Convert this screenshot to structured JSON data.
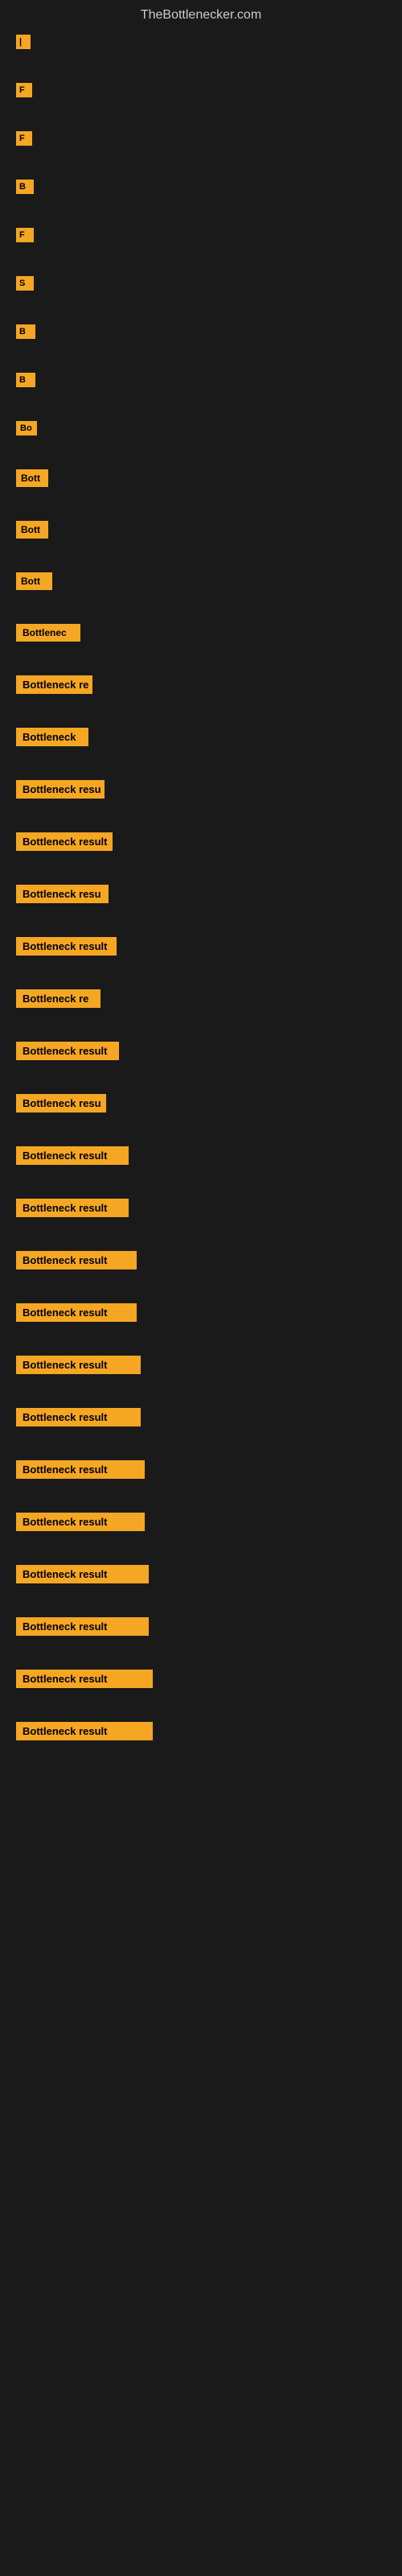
{
  "site": {
    "title": "TheBottlenecker.com"
  },
  "items": [
    {
      "id": 1,
      "label": "|",
      "class": "item-1"
    },
    {
      "id": 2,
      "label": "F",
      "class": "item-2"
    },
    {
      "id": 3,
      "label": "F",
      "class": "item-3"
    },
    {
      "id": 4,
      "label": "B",
      "class": "item-4"
    },
    {
      "id": 5,
      "label": "F",
      "class": "item-5"
    },
    {
      "id": 6,
      "label": "S",
      "class": "item-6"
    },
    {
      "id": 7,
      "label": "B",
      "class": "item-7"
    },
    {
      "id": 8,
      "label": "B",
      "class": "item-8"
    },
    {
      "id": 9,
      "label": "Bo",
      "class": "item-9"
    },
    {
      "id": 10,
      "label": "Bott",
      "class": "item-10"
    },
    {
      "id": 11,
      "label": "Bott",
      "class": "item-11"
    },
    {
      "id": 12,
      "label": "Bott",
      "class": "item-12"
    },
    {
      "id": 13,
      "label": "Bottlenec",
      "class": "item-13"
    },
    {
      "id": 14,
      "label": "Bottleneck re",
      "class": "item-14"
    },
    {
      "id": 15,
      "label": "Bottleneck",
      "class": "item-15"
    },
    {
      "id": 16,
      "label": "Bottleneck resu",
      "class": "item-16"
    },
    {
      "id": 17,
      "label": "Bottleneck result",
      "class": "item-17"
    },
    {
      "id": 18,
      "label": "Bottleneck resu",
      "class": "item-18"
    },
    {
      "id": 19,
      "label": "Bottleneck result",
      "class": "item-19"
    },
    {
      "id": 20,
      "label": "Bottleneck re",
      "class": "item-20"
    },
    {
      "id": 21,
      "label": "Bottleneck result",
      "class": "item-21"
    },
    {
      "id": 22,
      "label": "Bottleneck resu",
      "class": "item-22"
    },
    {
      "id": 23,
      "label": "Bottleneck result",
      "class": "item-23"
    },
    {
      "id": 24,
      "label": "Bottleneck result",
      "class": "item-24"
    },
    {
      "id": 25,
      "label": "Bottleneck result",
      "class": "item-25"
    },
    {
      "id": 26,
      "label": "Bottleneck result",
      "class": "item-26"
    },
    {
      "id": 27,
      "label": "Bottleneck result",
      "class": "item-27"
    },
    {
      "id": 28,
      "label": "Bottleneck result",
      "class": "item-28"
    },
    {
      "id": 29,
      "label": "Bottleneck result",
      "class": "item-29"
    },
    {
      "id": 30,
      "label": "Bottleneck result",
      "class": "item-30"
    },
    {
      "id": 31,
      "label": "Bottleneck result",
      "class": "item-31"
    },
    {
      "id": 32,
      "label": "Bottleneck result",
      "class": "item-32"
    },
    {
      "id": 33,
      "label": "Bottleneck result",
      "class": "item-33"
    },
    {
      "id": 34,
      "label": "Bottleneck result",
      "class": "item-34"
    }
  ]
}
